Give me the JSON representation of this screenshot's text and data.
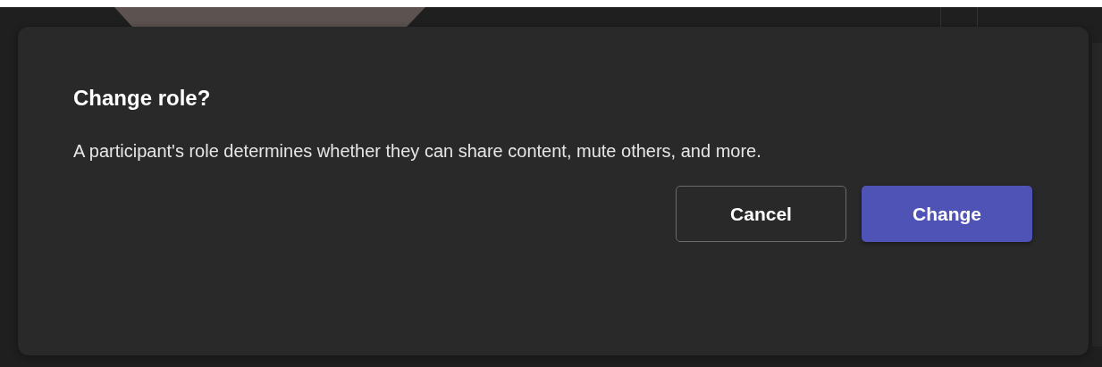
{
  "dialog": {
    "title": "Change role?",
    "message": "A participant's role determines whether they can share content, mute others, and more.",
    "buttons": [
      {
        "label": "Cancel",
        "kind": "secondary"
      },
      {
        "label": "Change",
        "kind": "primary"
      }
    ]
  }
}
